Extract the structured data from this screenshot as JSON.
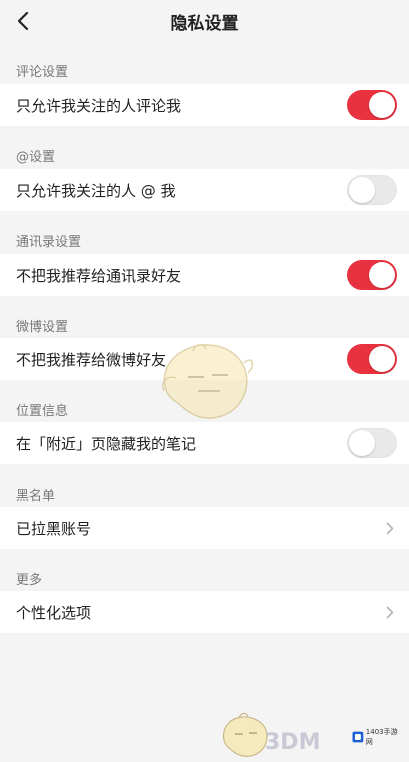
{
  "header": {
    "title": "隐私设置"
  },
  "sections": [
    {
      "label": "评论设置",
      "row": {
        "label": "只允许我关注的人评论我",
        "toggle": "on"
      }
    },
    {
      "label": "@设置",
      "row": {
        "label": "只允许我关注的人 @ 我",
        "toggle": "off"
      }
    },
    {
      "label": "通讯录设置",
      "row": {
        "label": "不把我推荐给通讯录好友",
        "toggle": "on"
      }
    },
    {
      "label": "微博设置",
      "row": {
        "label": "不把我推荐给微博好友",
        "toggle": "on"
      }
    },
    {
      "label": "位置信息",
      "row": {
        "label": "在「附近」页隐藏我的笔记",
        "toggle": "off"
      }
    },
    {
      "label": "黑名单",
      "row": {
        "label": "已拉黑账号",
        "chevron": true
      }
    },
    {
      "label": "更多",
      "row": {
        "label": "个性化选项",
        "chevron": true
      }
    }
  ],
  "colors": {
    "toggle_on": "#e8323f",
    "toggle_off": "#e9e9e9",
    "background": "#f4f4f4"
  },
  "icons": {
    "back": "chevron-left-icon",
    "arrow": "chevron-right-icon"
  },
  "watermark": {
    "brand": "3DM",
    "site": "1403手游网"
  }
}
